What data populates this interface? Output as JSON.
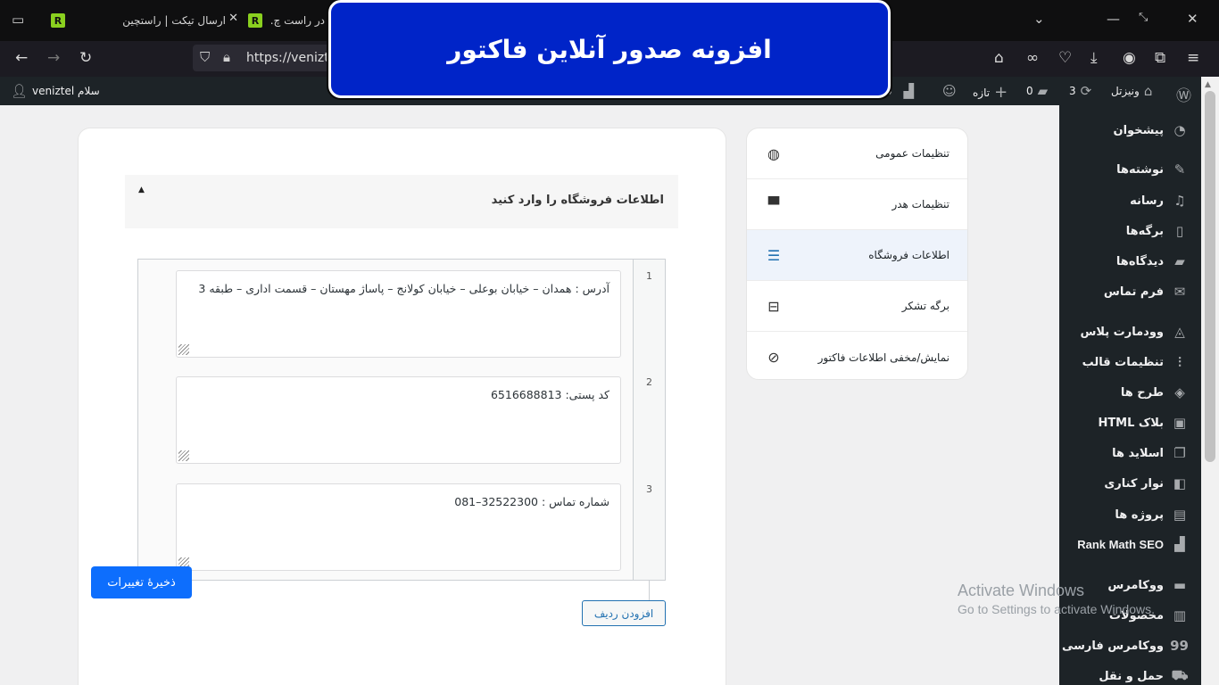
{
  "browser": {
    "tabs": [
      {
        "title": "ارسال تیکت | راستچین"
      },
      {
        "title": "در راست چ..."
      }
    ],
    "url": "https://venizte"
  },
  "banner": {
    "title": "افزونه صدور آنلاین فاکتور"
  },
  "adminbar": {
    "greeting": "سلام veniztel",
    "site_name": "ونیزتل",
    "updates_count": "3",
    "comments_count": "0",
    "new_label": "تازه",
    "rankmath_count": "0"
  },
  "sidebar": {
    "items": [
      {
        "label": "پیشخوان",
        "icon": "dashboard-icon"
      },
      {
        "label": "نوشته‌ها",
        "icon": "pin-icon"
      },
      {
        "label": "رسانه",
        "icon": "media-icon"
      },
      {
        "label": "برگه‌ها",
        "icon": "pages-icon"
      },
      {
        "label": "دیدگاه‌ها",
        "icon": "comment-icon"
      },
      {
        "label": "فرم تماس",
        "icon": "mail-icon"
      },
      {
        "label": "وودمارت پلاس",
        "icon": "woodmart-icon"
      },
      {
        "label": "تنظیمات قالب",
        "icon": "sliders-icon"
      },
      {
        "label": "طرح ها",
        "icon": "layers-icon"
      },
      {
        "label": "بلاک HTML",
        "icon": "html-icon"
      },
      {
        "label": "اسلاید ها",
        "icon": "slides-icon"
      },
      {
        "label": "نوار کناری",
        "icon": "sidebar-icon"
      },
      {
        "label": "پروژه ها",
        "icon": "briefcase-icon"
      },
      {
        "label": "Rank Math SEO",
        "icon": "rankmath-icon"
      },
      {
        "label": "ووکامرس",
        "icon": "woo-icon"
      },
      {
        "label": "محصولات",
        "icon": "archive-icon"
      },
      {
        "label": "ووکامرس فارسی",
        "icon": "woo-fa-icon"
      },
      {
        "label": "حمل و نقل",
        "icon": "truck-icon"
      }
    ]
  },
  "settings_nav": {
    "items": [
      {
        "label": "تنظیمات عمومی",
        "icon": "globe-icon"
      },
      {
        "label": "تنظیمات هدر",
        "icon": "monitor-icon"
      },
      {
        "label": "اطلاعات فروشگاه",
        "icon": "list-icon"
      },
      {
        "label": "برگه تشکر",
        "icon": "thankyou-icon"
      },
      {
        "label": "نمایش/مخفی اطلاعات فاکتور",
        "icon": "eye-slash-icon"
      }
    ]
  },
  "section": {
    "title": "اطلاعات فروشگاه را وارد کنید"
  },
  "repeater": {
    "rows": [
      {
        "num": "1",
        "value": "آدرس :  همدان – خیابان بوعلی – خیابان کولانج – پاساژ مهستان – قسمت اداری – طبقه 3"
      },
      {
        "num": "2",
        "value": "کد پستی: 6516688813"
      },
      {
        "num": "3",
        "value": "شماره تماس : 32522300–081"
      }
    ]
  },
  "buttons": {
    "add_row": "افزودن ردیف",
    "save": "ذخیرهٔ تغییرات"
  },
  "watermark": {
    "title": "Activate Windows",
    "subtitle": "Go to Settings to activate Windows."
  }
}
